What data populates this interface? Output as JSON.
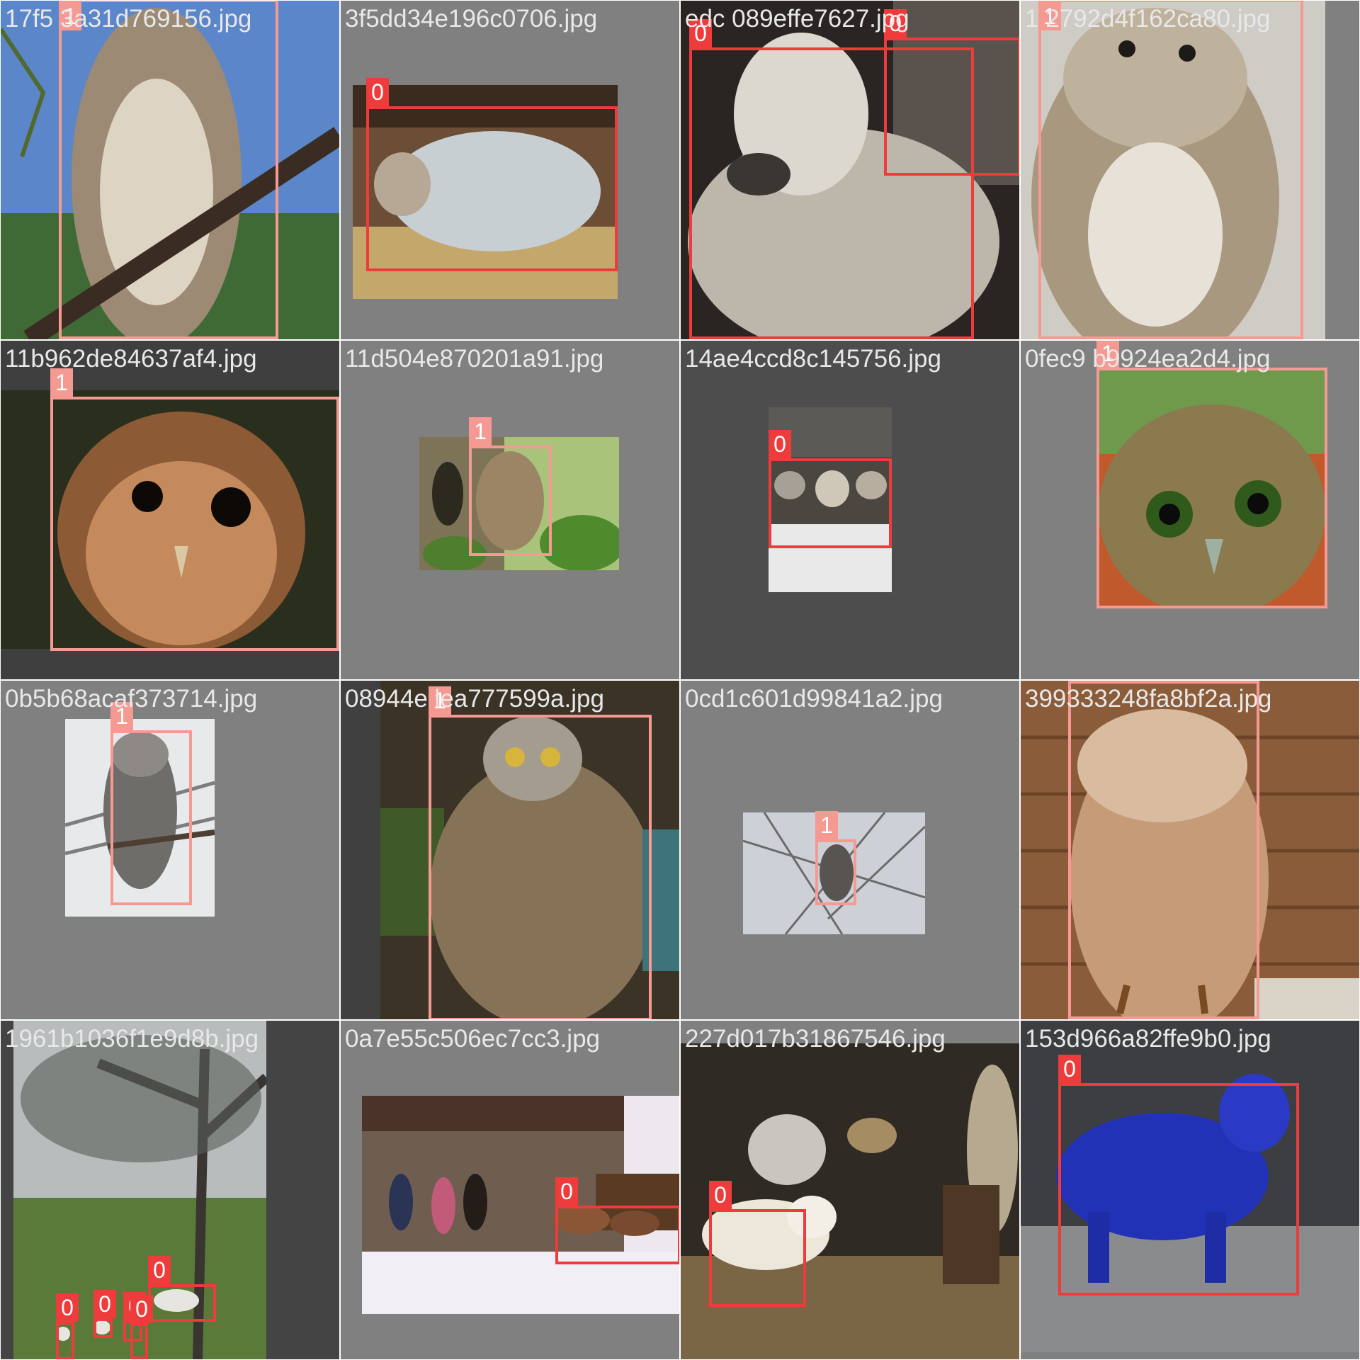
{
  "colors": {
    "class_0": "#ee3b3b",
    "class_1": "#f59a93",
    "label_text": "#ffffff",
    "filename_text": "#e8e8e8",
    "tile_background": "#808080"
  },
  "tiles": [
    {
      "filename": "17f5 3a31d769156.jpg",
      "subject": "tawny owl on branch",
      "labels": [
        "1"
      ]
    },
    {
      "filename": "3f5dd34e196c0706.jpg",
      "subject": "sheep in straw pen",
      "labels": [
        "0"
      ]
    },
    {
      "filename": "edc 089effe7627.jpg",
      "subject": "sheep face close-up",
      "labels": [
        "0",
        "0"
      ]
    },
    {
      "filename": "1 2792d4f162ca80.jpg",
      "subject": "striped owl",
      "labels": [
        "1"
      ]
    },
    {
      "filename": "11b962de84637af4.jpg",
      "subject": "tawny owl face",
      "labels": [
        "1"
      ]
    },
    {
      "filename": "11d504e870201a91.jpg",
      "subject": "owl in tree hollow",
      "labels": [
        "1"
      ]
    },
    {
      "filename": "14ae4ccd8c145756.jpg",
      "subject": "sheep flock in snow",
      "labels": [
        "0"
      ]
    },
    {
      "filename": "0fec9 b9924ea2d4.jpg",
      "subject": "screech owl green eyes",
      "labels": [
        "1"
      ]
    },
    {
      "filename": "0b5b68acaf373714.jpg",
      "subject": "barred owl in snow",
      "labels": [
        "1"
      ]
    },
    {
      "filename": "08944e lea777599a.jpg",
      "subject": "young eagle owl",
      "labels": [
        "1"
      ]
    },
    {
      "filename": "0cd1c601d99841a2.jpg",
      "subject": "owl in bare branches",
      "labels": [
        "1"
      ]
    },
    {
      "filename": "399333248fa8bf2a.jpg",
      "subject": "owl by brick wall",
      "labels": [
        "1"
      ]
    },
    {
      "filename": "1961b1036f1e9d8b.jpg",
      "subject": "sheep grazing under tree",
      "labels": [
        "0",
        "0",
        "0",
        "0",
        "0"
      ]
    },
    {
      "filename": "0a7e55c506ec7cc3.jpg",
      "subject": "people and sheep by stone barn",
      "labels": [
        "0"
      ]
    },
    {
      "filename": "227d017b31867546.jpg",
      "subject": "nativity scene sheep",
      "labels": [
        "0"
      ]
    },
    {
      "filename": "153d966a82ffe9b0.jpg",
      "subject": "blue sheep statue",
      "labels": [
        "0"
      ]
    }
  ]
}
